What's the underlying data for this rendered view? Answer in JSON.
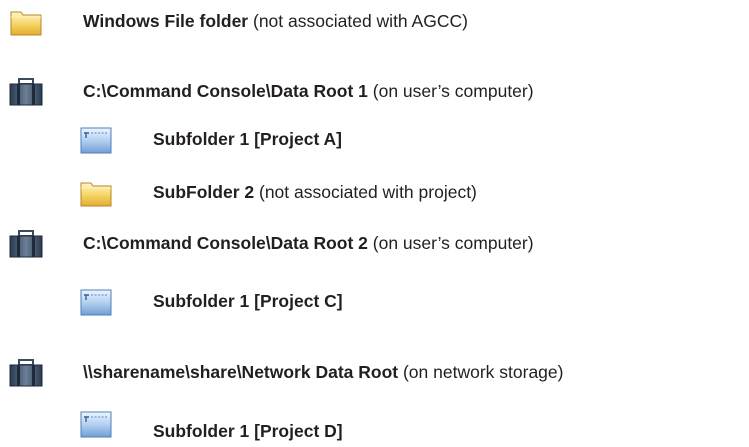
{
  "items": [
    {
      "icon": "yellow-folder-icon",
      "name": "Windows File folder",
      "note": "(not associated with AGCC)"
    },
    {
      "icon": "data-root-icon",
      "name": "C:\\Command Console\\Data Root 1",
      "note": "(on user’s computer)"
    },
    {
      "icon": "project-folder-icon",
      "name": "Subfolder 1 [Project A]",
      "note": ""
    },
    {
      "icon": "yellow-folder-icon",
      "name": "SubFolder 2",
      "note": "(not associated with project)"
    },
    {
      "icon": "data-root-icon",
      "name": "C:\\Command Console\\Data Root 2",
      "note": "(on user’s computer)"
    },
    {
      "icon": "project-folder-icon",
      "name": "Subfolder 1 [Project C]",
      "note": ""
    },
    {
      "icon": "data-root-icon",
      "name": "\\\\sharename\\share\\Network Data Root",
      "note": "(on network storage)"
    },
    {
      "icon": "project-folder-icon",
      "name": "Subfolder 1 [Project D]",
      "note": ""
    }
  ]
}
